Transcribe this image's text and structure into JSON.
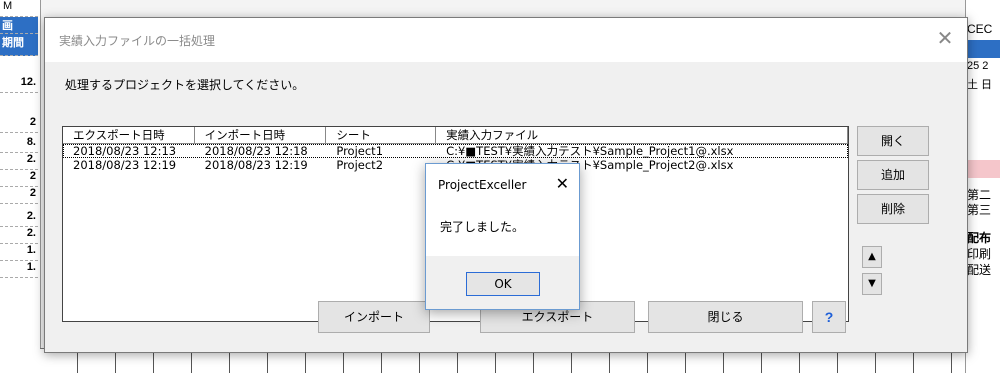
{
  "background": {
    "left_cells": [
      "M",
      "画",
      "期間",
      "12.",
      "2",
      "8.",
      "2.",
      "2",
      "2",
      "2.",
      "2.",
      "1.",
      "1."
    ],
    "right_texts": [
      "CEC",
      "25 2",
      "土 日",
      "第二",
      "第三",
      "配布",
      "印刷",
      "配送"
    ]
  },
  "dialog": {
    "title": "実績入力ファイルの一括処理",
    "instruction": "処理するプロジェクトを選択してください。",
    "columns": [
      "エクスポート日時",
      "インポート日時",
      "シート",
      "実績入力ファイル"
    ],
    "rows": [
      [
        "2018/08/23 12:13",
        "2018/08/23 12:18",
        "Project1",
        "C:¥■TEST¥実績入力テスト¥Sample_Project1@.xlsx"
      ],
      [
        "2018/08/23 12:19",
        "2018/08/23 12:19",
        "Project2",
        "C:¥■TEST¥実績入力テスト¥Sample_Project2@.xlsx"
      ]
    ],
    "buttons": {
      "open": "開く",
      "add": "追加",
      "delete": "削除",
      "import": "インポート",
      "export": "エクスポート",
      "close": "閉じる",
      "help": "?",
      "up": "▲",
      "down": "▼"
    },
    "close_glyph": "✕"
  },
  "message_box": {
    "title": "ProjectExceller",
    "close_glyph": "✕",
    "message": "完了しました。",
    "ok": "OK"
  }
}
